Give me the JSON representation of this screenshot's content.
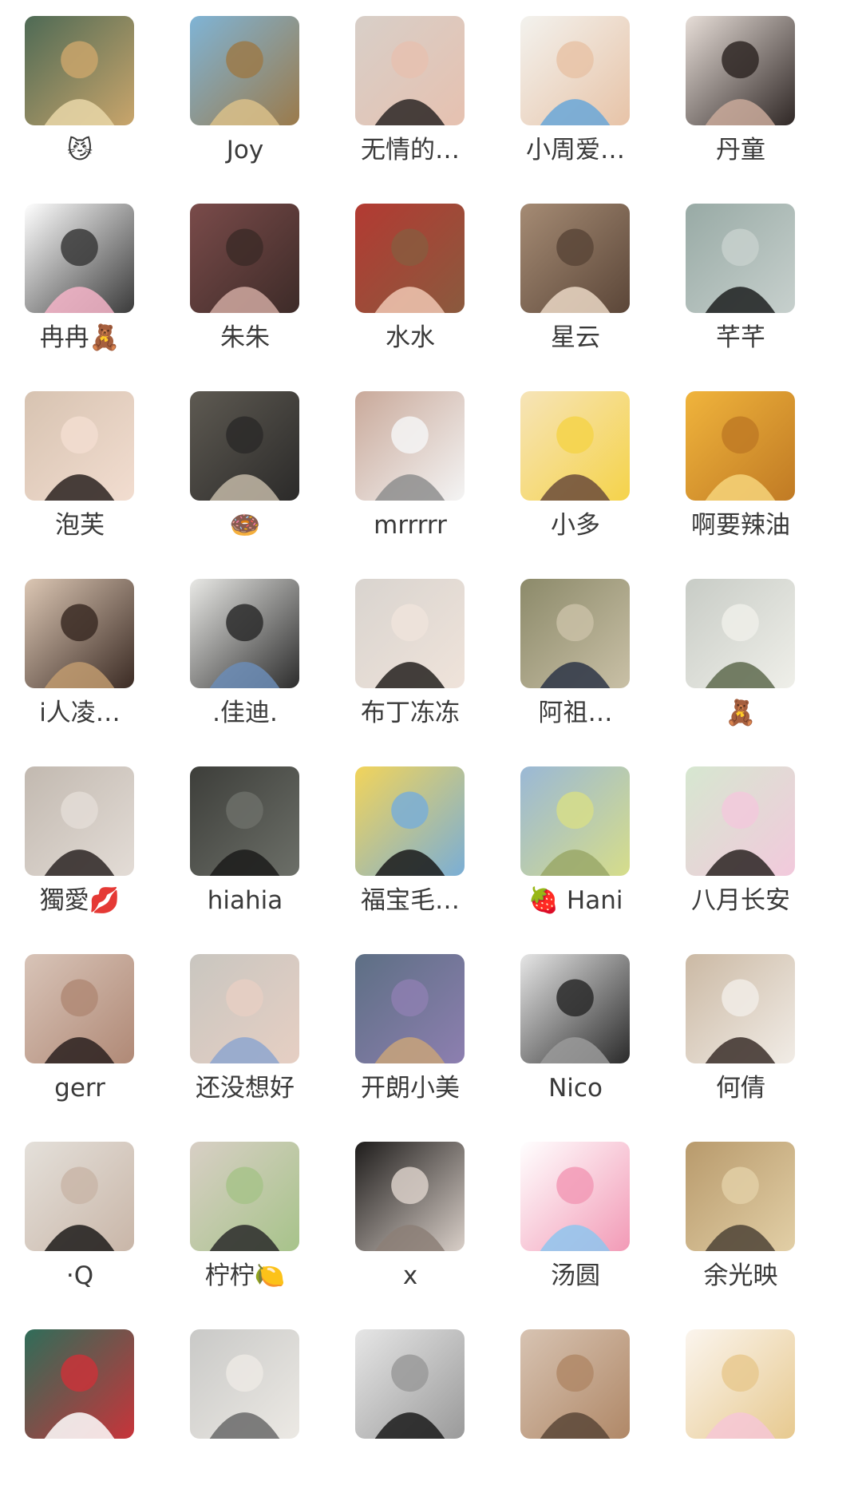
{
  "members": [
    {
      "name": "😼",
      "avatar": "cat-with-plush-avatar",
      "colors": [
        "#4e6a55",
        "#e9d7a8",
        "#c9a56b"
      ]
    },
    {
      "name": "Joy",
      "avatar": "beach-shore-avatar",
      "colors": [
        "#7fb4d6",
        "#d9c08a",
        "#9b7a4a"
      ]
    },
    {
      "name": "无情的…",
      "avatar": "girl-portrait-avatar",
      "colors": [
        "#d8cfc8",
        "#2c2624",
        "#e6c1b0"
      ]
    },
    {
      "name": "小周爱…",
      "avatar": "girl-with-chip-bag-avatar",
      "colors": [
        "#f3f2ee",
        "#6aa7d8",
        "#e7c3a7"
      ]
    },
    {
      "name": "丹童",
      "avatar": "girl-sitting-avatar",
      "colors": [
        "#e7ded8",
        "#c9a99a",
        "#2f2725"
      ]
    },
    {
      "name": "冉冉🧸",
      "avatar": "hello-kitty-cartoon-avatar",
      "colors": [
        "#ffffff",
        "#f4b4c8",
        "#3a3a3a"
      ]
    },
    {
      "name": "朱朱",
      "avatar": "girl-in-flowers-avatar",
      "colors": [
        "#7a4b4a",
        "#cfa8a0",
        "#3d2b28"
      ]
    },
    {
      "name": "水水",
      "avatar": "girl-with-cat-avatar",
      "colors": [
        "#b33a32",
        "#f0c7b3",
        "#8a5a3e"
      ]
    },
    {
      "name": "星云",
      "avatar": "girl-in-room-avatar",
      "colors": [
        "#a58b74",
        "#ead7c4",
        "#5b4638"
      ]
    },
    {
      "name": "芊芊",
      "avatar": "girl-in-black-avatar",
      "colors": [
        "#98aaa5",
        "#1d2020",
        "#c7d0cd"
      ]
    },
    {
      "name": "泡芙",
      "avatar": "anime-girl-avatar",
      "colors": [
        "#d7c3b1",
        "#2a2220",
        "#f2ddd0"
      ]
    },
    {
      "name": "🍩",
      "avatar": "person-at-cafe-avatar",
      "colors": [
        "#5e5a52",
        "#c2b7a6",
        "#2b2a29"
      ]
    },
    {
      "name": "mrrrrr",
      "avatar": "grey-cartoon-bear-avatar",
      "colors": [
        "#c9a99a",
        "#8e8e8e",
        "#f4f4f4"
      ]
    },
    {
      "name": "小多",
      "avatar": "cartoon-girl-bun-avatar",
      "colors": [
        "#f6e4b8",
        "#6b4b39",
        "#f5d34a"
      ]
    },
    {
      "name": "啊要辣油",
      "avatar": "golden-baby-cartoon-avatar",
      "colors": [
        "#f0b43c",
        "#f6d37a",
        "#c07a24"
      ]
    },
    {
      "name": "i人凌…",
      "avatar": "girl-with-mirror-avatar",
      "colors": [
        "#dcc7b4",
        "#c09a6e",
        "#3b2b24"
      ]
    },
    {
      "name": ".佳迪.",
      "avatar": "person-jumping-avatar",
      "colors": [
        "#e9e9e6",
        "#6b8cb6",
        "#2c2c2c"
      ]
    },
    {
      "name": "布丁冻冻",
      "avatar": "girl-in-car-avatar",
      "colors": [
        "#d9d4cf",
        "#25211f",
        "#efe3da"
      ]
    },
    {
      "name": "阿祖…",
      "avatar": "man-sitting-avatar",
      "colors": [
        "#8c8a6a",
        "#2d3546",
        "#c9c0a6"
      ]
    },
    {
      "name": "🧸",
      "avatar": "girl-crouching-avatar",
      "colors": [
        "#c8ccc6",
        "#5e6a4e",
        "#efefe9"
      ]
    },
    {
      "name": "獨愛💋",
      "avatar": "woman-by-sea-avatar",
      "colors": [
        "#c2b9b0",
        "#2b2523",
        "#e3dcd6"
      ]
    },
    {
      "name": "hiahia",
      "avatar": "man-with-umbrella-avatar",
      "colors": [
        "#3d3e3a",
        "#1b1b1a",
        "#6c6f68"
      ]
    },
    {
      "name": "福宝毛…",
      "avatar": "black-cat-illustration-avatar",
      "colors": [
        "#f2d45a",
        "#1a1a1a",
        "#7aaed6"
      ]
    },
    {
      "name": "🍓 Hani",
      "avatar": "girl-on-grass-avatar",
      "colors": [
        "#9ab8d6",
        "#9aa868",
        "#d6dd8a"
      ]
    },
    {
      "name": "八月长安",
      "avatar": "anime-girl-lotus-avatar",
      "colors": [
        "#d6e7d0",
        "#2a2322",
        "#f2c9dc"
      ]
    },
    {
      "name": "gerr",
      "avatar": "woman-closeup-avatar",
      "colors": [
        "#d8c4b8",
        "#2a201e",
        "#b08976"
      ]
    },
    {
      "name": "还没想好",
      "avatar": "girl-hands-on-face-avatar",
      "colors": [
        "#c9c6c0",
        "#8ea6cf",
        "#e6cfc3"
      ]
    },
    {
      "name": "开朗小美",
      "avatar": "girl-on-beach-night-avatar",
      "colors": [
        "#5d6f84",
        "#c8a37a",
        "#8d7fb0"
      ]
    },
    {
      "name": "Nico",
      "avatar": "blonde-girl-mono-avatar",
      "colors": [
        "#e6e6e6",
        "#9a9a9a",
        "#2a2a2a"
      ]
    },
    {
      "name": "何倩",
      "avatar": "woman-with-flowers-avatar",
      "colors": [
        "#cbb9a4",
        "#3b2f2a",
        "#f1ece6"
      ]
    },
    {
      "name": "·Q",
      "avatar": "woman-black-coat-avatar",
      "colors": [
        "#e4e0da",
        "#1d1b1a",
        "#c9b6a8"
      ]
    },
    {
      "name": "柠柠🍋",
      "avatar": "cat-with-sunglasses-avatar",
      "colors": [
        "#d8cfc5",
        "#2a2a2a",
        "#a7c38a"
      ]
    },
    {
      "name": "x",
      "avatar": "girl-dark-portrait-avatar",
      "colors": [
        "#1e1c1b",
        "#8c7f77",
        "#d9cfc8"
      ]
    },
    {
      "name": "汤圆",
      "avatar": "cinnamoroll-rainbow-avatar",
      "colors": [
        "#ffffff",
        "#8fc6ee",
        "#f29ab6"
      ]
    },
    {
      "name": "余光映",
      "avatar": "man-on-motorbike-avatar",
      "colors": [
        "#b89a6c",
        "#4e4336",
        "#e2cfa6"
      ]
    },
    {
      "name": "",
      "avatar": "hello-kitty-shower-avatar",
      "colors": [
        "#2f6d59",
        "#ffffff",
        "#c8343a"
      ]
    },
    {
      "name": "",
      "avatar": "cat-with-laptop-avatar",
      "colors": [
        "#c9c9c7",
        "#6a6a6a",
        "#ece9e4"
      ]
    },
    {
      "name": "",
      "avatar": "blurred-silhouette-avatar",
      "colors": [
        "#e6e6e6",
        "#1b1b1b",
        "#9a9a9a"
      ]
    },
    {
      "name": "",
      "avatar": "girl-with-cat-selfie-avatar",
      "colors": [
        "#d7c3b2",
        "#5a4637",
        "#b08867"
      ]
    },
    {
      "name": "",
      "avatar": "kitty-cake-cartoon-avatar",
      "colors": [
        "#fbf5ee",
        "#f6c7d6",
        "#e7c98f"
      ]
    }
  ]
}
